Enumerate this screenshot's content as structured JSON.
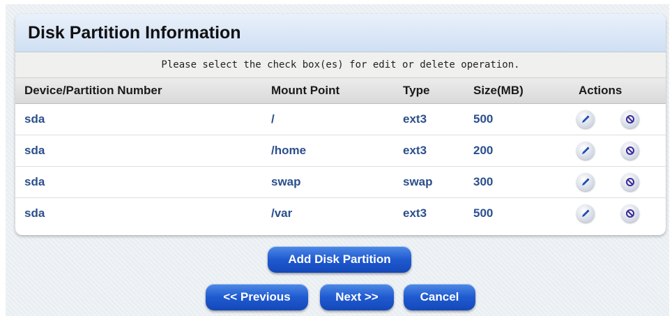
{
  "panel": {
    "title": "Disk Partition Information",
    "instruction": "Please select the check box(es) for edit or delete operation."
  },
  "table": {
    "headers": [
      "Device/Partition Number",
      "Mount Point",
      "Type",
      "Size(MB)",
      "Actions"
    ],
    "rows": [
      {
        "device": "sda",
        "mount": "/",
        "type": "ext3",
        "size": "500"
      },
      {
        "device": "sda",
        "mount": "/home",
        "type": "ext3",
        "size": "200"
      },
      {
        "device": "sda",
        "mount": "swap",
        "type": "swap",
        "size": "300"
      },
      {
        "device": "sda",
        "mount": "/var",
        "type": "ext3",
        "size": "500"
      }
    ],
    "row_actions": [
      "edit-icon",
      "delete-icon"
    ]
  },
  "buttons": {
    "add": "Add Disk Partition",
    "previous": "<< Previous",
    "next": "Next >>",
    "cancel": "Cancel"
  },
  "colors": {
    "accent": "#1f5ad0",
    "cell_text": "#2b4f8c",
    "title_bar": "#dbe7f6"
  }
}
